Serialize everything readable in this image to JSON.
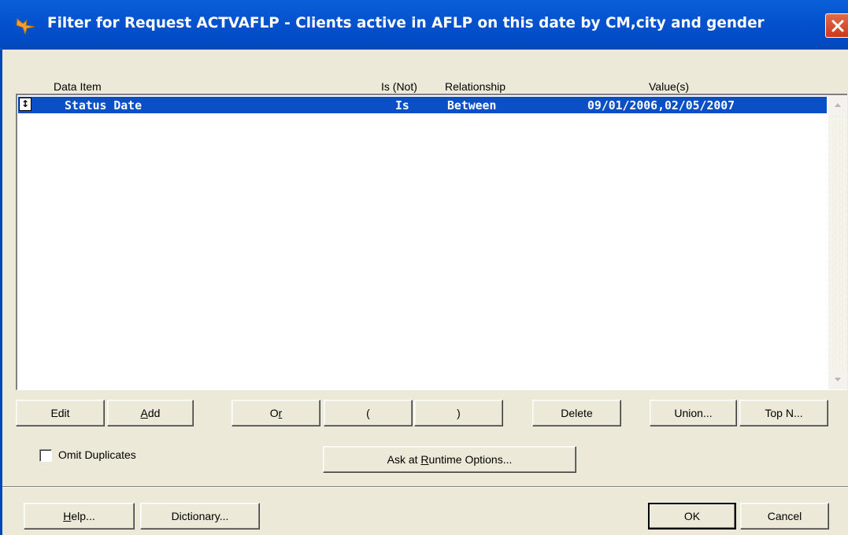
{
  "window": {
    "title": "Filter for Request ACTVAFLP - Clients active in AFLP on this date by CM,city and gender",
    "icon": "fox-app-icon",
    "close_icon": "close-icon"
  },
  "columns": {
    "data_item": "Data Item",
    "is_not": "Is (Not)",
    "relationship": "Relationship",
    "values": "Value(s)"
  },
  "rows": [
    {
      "handle": "↕",
      "data_item": "Status Date",
      "is_not": "Is",
      "relationship": "Between",
      "values": "09/01/2006,02/05/2007"
    }
  ],
  "buttons": {
    "edit": "Edit",
    "add": {
      "pre": "",
      "mn": "A",
      "post": "dd"
    },
    "or": {
      "pre": "O",
      "mn": "r",
      "post": ""
    },
    "open_paren": "(",
    "close_paren": ")",
    "delete": "Delete",
    "union": "Union...",
    "top_n": "Top N...",
    "ask_runtime": {
      "pre": "Ask at ",
      "mn": "R",
      "post": "untime Options..."
    },
    "help": {
      "pre": "",
      "mn": "H",
      "post": "elp..."
    },
    "dictionary": "Dictionary...",
    "ok": "OK",
    "cancel": "Cancel"
  },
  "options": {
    "omit_duplicates_label": "Omit Duplicates",
    "omit_duplicates_checked": false
  },
  "colors": {
    "titlebar": "#0553d0",
    "selection": "#0a4fc6",
    "dialog_bg": "#ece9d8"
  }
}
